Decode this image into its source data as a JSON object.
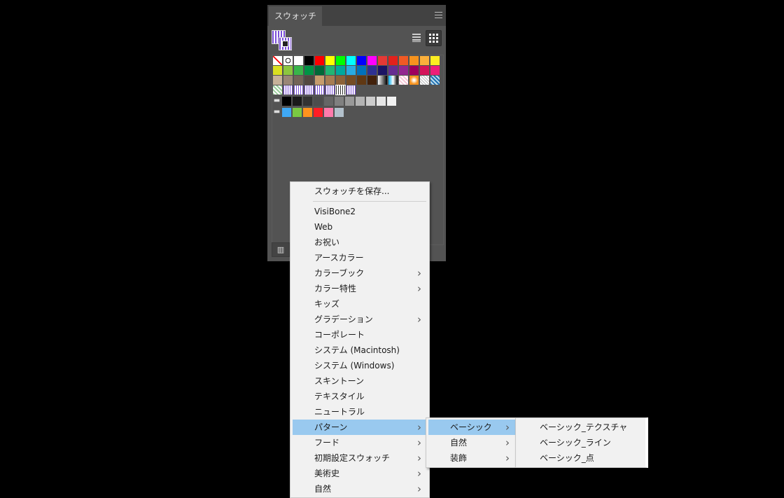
{
  "panel": {
    "tab_label": "スウォッチ",
    "swatch_rows": [
      [
        "none",
        "registration",
        "#ffffff",
        "#000000",
        "#ff0000",
        "#ffff00",
        "#00ff00",
        "#00ffff",
        "#0000ff",
        "#ff00ff",
        "#e53935",
        "#e2211c",
        "#f15a24",
        "#f7931e",
        "#fbb03b",
        "#fcee21"
      ],
      [
        "#d9e021",
        "#8cc63f",
        "#39b54a",
        "#009245",
        "#006837",
        "#22b573",
        "#00a99d",
        "#29abe2",
        "#0071bc",
        "#2e3192",
        "#1b1464",
        "#662d91",
        "#93278f",
        "#9e005d",
        "#d4145a",
        "#ed1e79"
      ],
      [
        "#c7b299",
        "#998675",
        "#736357",
        "#534741",
        "#c69c6d",
        "#a67c52",
        "#8c6239",
        "#754c24",
        "#603813",
        "#42210b",
        "#gradient1",
        "#gradient2",
        "#pattern-pink",
        "#radial",
        "#pattern-grid",
        "#pattern-blue"
      ],
      [
        "#pattern-green",
        "#stripes",
        "#stripes",
        "#stripes",
        "#stripes",
        "#stripes",
        "#selected-pattern",
        "#stripes"
      ]
    ],
    "folder_rows": [
      [
        "#000000",
        "#1a1a1a",
        "#333333",
        "#4d4d4d",
        "#666666",
        "#808080",
        "#999999",
        "#b3b3b3",
        "#cccccc",
        "#e6e6e6",
        "#f2f2f2"
      ],
      [
        "#3fa9f5",
        "#7ac943",
        "#ff931e",
        "#ff1d25",
        "#ff7bac",
        "#b3c1cc"
      ]
    ]
  },
  "menu1": {
    "items": [
      {
        "label": "スウォッチを保存...",
        "submenu": false
      },
      {
        "label": "VisiBone2",
        "submenu": false
      },
      {
        "label": "Web",
        "submenu": false
      },
      {
        "label": "お祝い",
        "submenu": false
      },
      {
        "label": "アースカラー",
        "submenu": false
      },
      {
        "label": "カラーブック",
        "submenu": true
      },
      {
        "label": "カラー特性",
        "submenu": true
      },
      {
        "label": "キッズ",
        "submenu": false
      },
      {
        "label": "グラデーション",
        "submenu": true
      },
      {
        "label": "コーポレート",
        "submenu": false
      },
      {
        "label": "システム (Macintosh)",
        "submenu": false
      },
      {
        "label": "システム (Windows)",
        "submenu": false
      },
      {
        "label": "スキントーン",
        "submenu": false
      },
      {
        "label": "テキスタイル",
        "submenu": false
      },
      {
        "label": "ニュートラル",
        "submenu": false
      },
      {
        "label": "パターン",
        "submenu": true,
        "highlighted": true
      },
      {
        "label": "フード",
        "submenu": true
      },
      {
        "label": "初期設定スウォッチ",
        "submenu": true
      },
      {
        "label": "美術史",
        "submenu": true
      },
      {
        "label": "自然",
        "submenu": true
      }
    ]
  },
  "menu2": {
    "items": [
      {
        "label": "ベーシック",
        "submenu": true,
        "highlighted": true
      },
      {
        "label": "自然",
        "submenu": true
      },
      {
        "label": "装飾",
        "submenu": true
      }
    ]
  },
  "menu3": {
    "items": [
      {
        "label": "ベーシック_テクスチャ"
      },
      {
        "label": "ベーシック_ライン"
      },
      {
        "label": "ベーシック_点"
      }
    ]
  },
  "colors": {
    "highlight": "#99c9ef",
    "panel_bg": "#535353",
    "menu_bg": "#f1f1f1"
  }
}
